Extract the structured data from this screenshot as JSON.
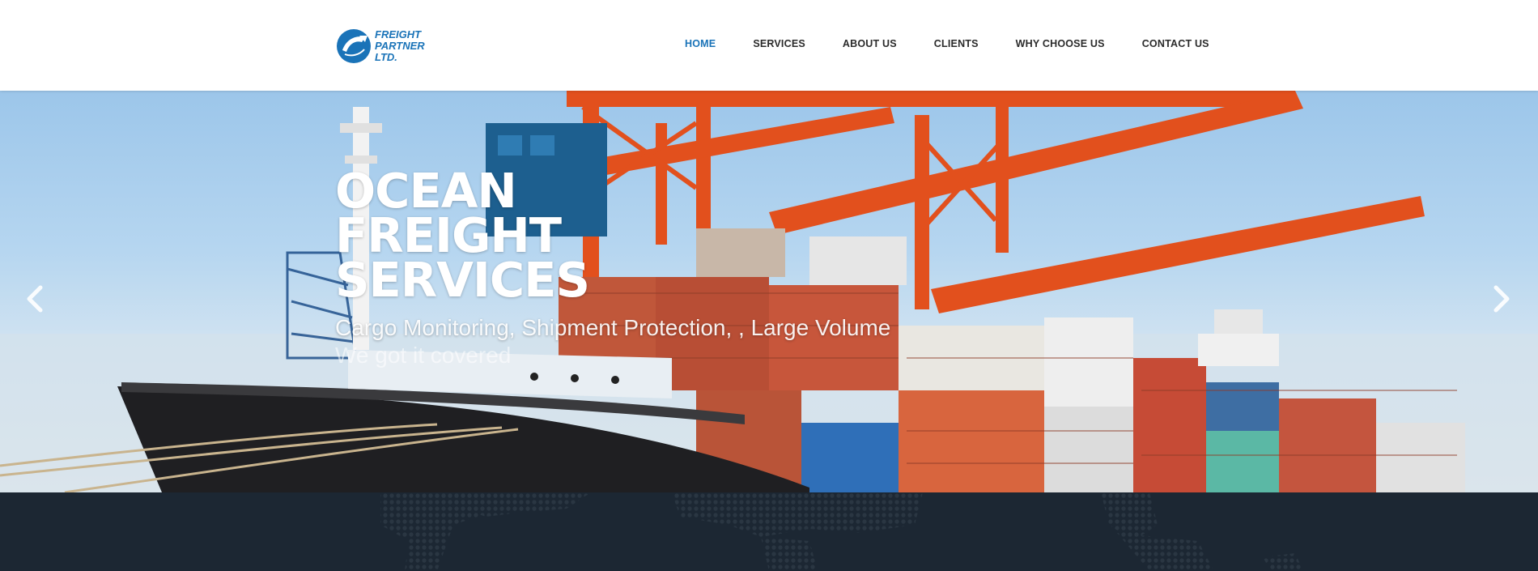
{
  "brand": {
    "logo_line1": "FREIGHT",
    "logo_line2": "PARTNER",
    "logo_line3": "LTD.",
    "color": "#1a73b8"
  },
  "nav": {
    "items": [
      {
        "label": "HOME",
        "active": true
      },
      {
        "label": "SERVICES",
        "active": false
      },
      {
        "label": "ABOUT US",
        "active": false
      },
      {
        "label": "CLIENTS",
        "active": false
      },
      {
        "label": "WHY CHOOSE US",
        "active": false
      },
      {
        "label": "CONTACT US",
        "active": false
      }
    ]
  },
  "hero": {
    "title_line1": "OCEAN",
    "title_line2": "FREIGHT",
    "title_line3": "SERVICES",
    "subtitle": "Cargo Monitoring, Shipment Protection, , Large Volume",
    "tagline": "We got it covered",
    "prev_icon": "chevron-left-icon",
    "next_icon": "chevron-right-icon"
  },
  "colors": {
    "header_bg": "#ffffff",
    "active_nav": "#1a73b8",
    "dark_strip": "#1c2733"
  }
}
